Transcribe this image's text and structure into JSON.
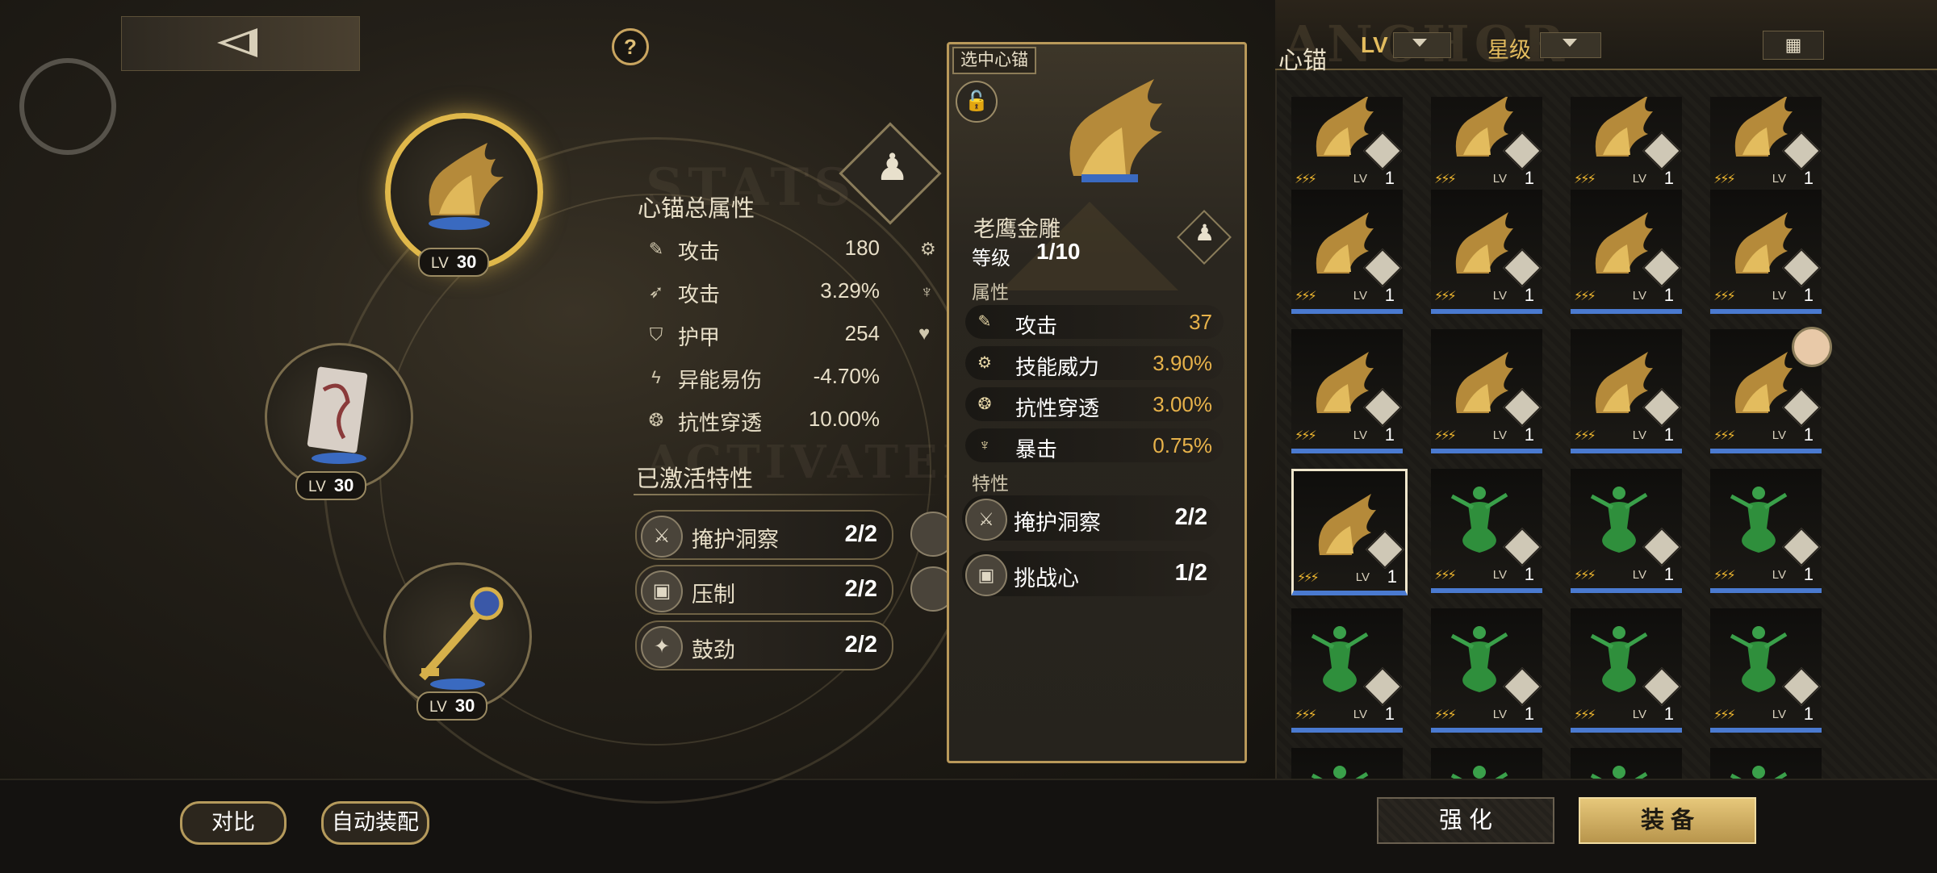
{
  "topbar": {
    "help_label": "?"
  },
  "slots": [
    {
      "level_label": "LV",
      "level": "30",
      "kind": "eagle"
    },
    {
      "level_label": "LV",
      "level": "30",
      "kind": "card"
    },
    {
      "level_label": "LV",
      "level": "30",
      "kind": "key"
    }
  ],
  "stats": {
    "title": "心锚总属性",
    "rows": [
      {
        "icon": "sword-icon",
        "label": "攻击",
        "value": "180"
      },
      {
        "icon": "arrow-icon",
        "label": "攻击",
        "value": "3.29%"
      },
      {
        "icon": "shield-icon",
        "label": "护甲",
        "value": "254"
      },
      {
        "icon": "bolt-icon",
        "label": "异能易伤",
        "value": "-4.70%"
      },
      {
        "icon": "swirl-icon",
        "label": "抗性穿透",
        "value": "10.00%"
      }
    ]
  },
  "traits": {
    "title": "已激活特性",
    "items": [
      {
        "name": "掩护洞察",
        "count": "2/2"
      },
      {
        "name": "压制",
        "count": "2/2"
      },
      {
        "name": "鼓劲",
        "count": "2/2"
      }
    ]
  },
  "watermarks": {
    "stats": "STATS",
    "activated": "ACTIVATED",
    "anchor": "ANCHOR"
  },
  "detail": {
    "tag": "选中心锚",
    "name": "老鹰金雕",
    "level_label": "等级",
    "level_value": "1/10",
    "attr_title": "属性",
    "attrs": [
      {
        "label": "攻击",
        "value": "37"
      },
      {
        "label": "技能威力",
        "value": "3.90%"
      },
      {
        "label": "抗性穿透",
        "value": "3.00%"
      },
      {
        "label": "暴击",
        "value": "0.75%"
      }
    ],
    "trait_title": "特性",
    "traits": [
      {
        "name": "掩护洞察",
        "count": "2/2"
      },
      {
        "name": "挑战心",
        "count": "1/2"
      }
    ]
  },
  "inventory": {
    "title": "心锚",
    "sort_lv": "LV",
    "sort_star": "星级",
    "tile_lv_label": "LV",
    "tile_level": "1"
  },
  "footer": {
    "compare_label": "对比",
    "auto_equip_label": "自动装配",
    "enhance_label": "强 化",
    "equip_label": "装 备"
  },
  "colors": {
    "accent_gold": "#e0b84a",
    "value_orange": "#e7b24a",
    "tile_border_blue": "#4a7ad0"
  }
}
